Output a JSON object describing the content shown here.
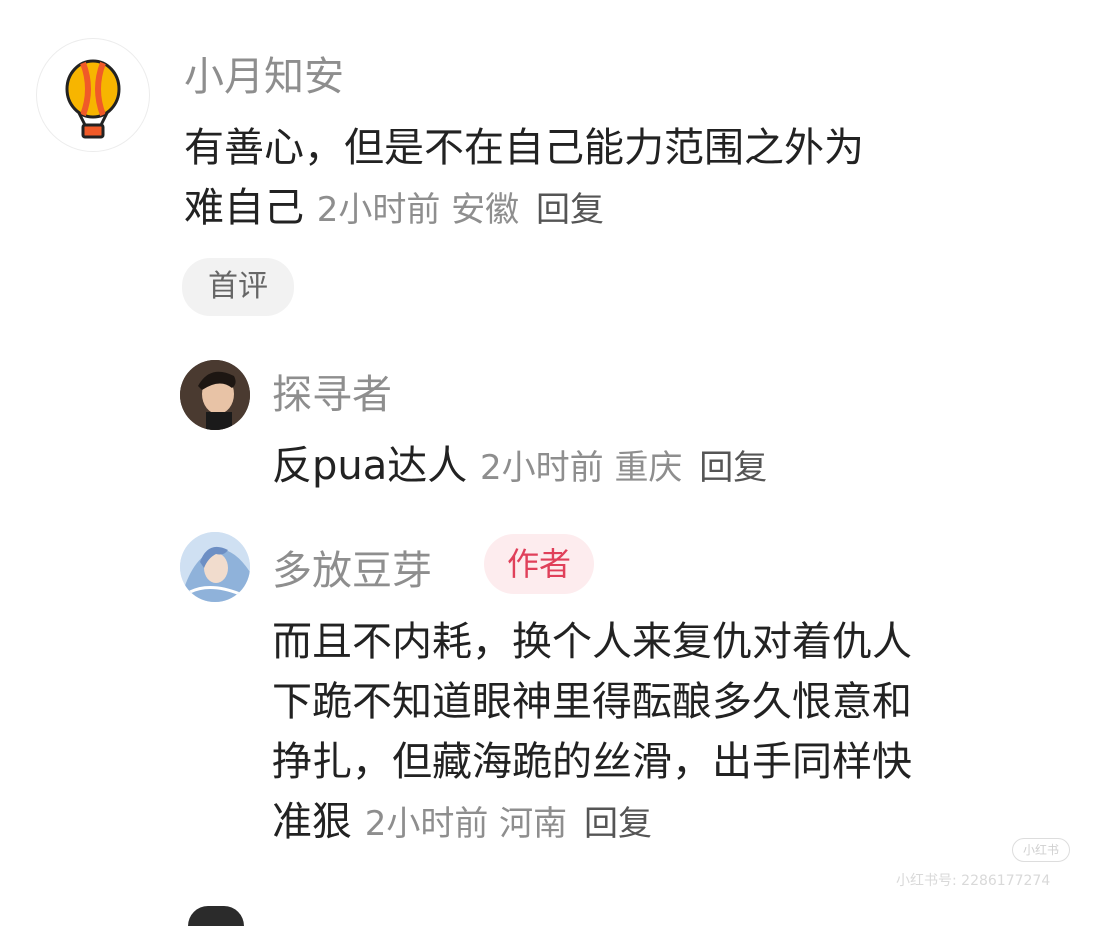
{
  "comments": [
    {
      "username": "小月知安",
      "avatar_icon": "hot-air-balloon-icon",
      "content_lines": [
        "有善心，但是不在自己能力范围之外为",
        "难自己"
      ],
      "time": "2小时前",
      "location": "安徽",
      "reply_label": "回复",
      "tag": "首评"
    },
    {
      "username": "探寻者",
      "avatar_icon": "person-portrait-icon",
      "content_lines": [
        "反pua达人"
      ],
      "time": "2小时前",
      "location": "重庆",
      "reply_label": "回复"
    },
    {
      "username": "多放豆芽",
      "avatar_icon": "anime-character-icon",
      "badge": "作者",
      "content_lines": [
        "而且不内耗，换个人来复仇对着仇人",
        "下跪不知道眼神里得酝酿多久恨意和",
        "挣扎，但藏海跪的丝滑，出手同样快",
        "准狠"
      ],
      "time": "2小时前",
      "location": "河南",
      "reply_label": "回复"
    }
  ],
  "watermark": {
    "logo_text": "小红书",
    "id_text": "小红书号: 2286177274"
  },
  "colors": {
    "username": "#8e8e8e",
    "text": "#222222",
    "author_badge_bg": "#fdecee",
    "author_badge_text": "#e0405a",
    "pill_bg": "#f2f2f2"
  }
}
